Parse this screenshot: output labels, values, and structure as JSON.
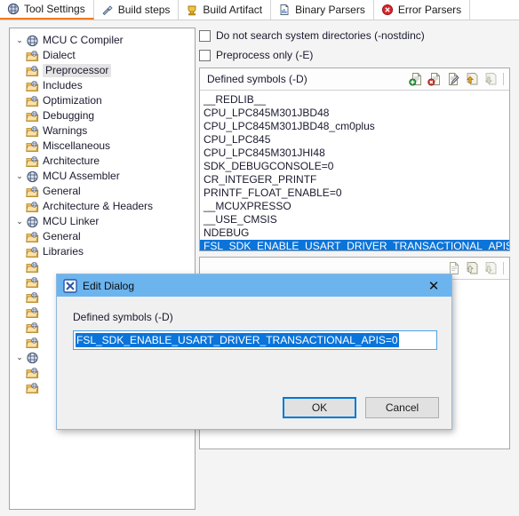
{
  "tabs": [
    {
      "label": "Tool Settings",
      "icon": "tool-settings-icon",
      "active": true
    },
    {
      "label": "Build steps",
      "icon": "build-steps-icon",
      "active": false
    },
    {
      "label": "Build Artifact",
      "icon": "build-artifact-icon",
      "active": false
    },
    {
      "label": "Binary Parsers",
      "icon": "binary-parsers-icon",
      "active": false
    },
    {
      "label": "Error Parsers",
      "icon": "error-parsers-icon",
      "active": false
    }
  ],
  "tree": [
    {
      "label": "MCU C Compiler",
      "level": 0,
      "expanded": true,
      "icon": "tool-icon",
      "selected": false
    },
    {
      "label": "Dialect",
      "level": 1,
      "icon": "folder-icon",
      "selected": false
    },
    {
      "label": "Preprocessor",
      "level": 1,
      "icon": "folder-icon",
      "selected": true
    },
    {
      "label": "Includes",
      "level": 1,
      "icon": "folder-icon",
      "selected": false
    },
    {
      "label": "Optimization",
      "level": 1,
      "icon": "folder-icon",
      "selected": false
    },
    {
      "label": "Debugging",
      "level": 1,
      "icon": "folder-icon",
      "selected": false
    },
    {
      "label": "Warnings",
      "level": 1,
      "icon": "folder-icon",
      "selected": false
    },
    {
      "label": "Miscellaneous",
      "level": 1,
      "icon": "folder-icon",
      "selected": false
    },
    {
      "label": "Architecture",
      "level": 1,
      "icon": "folder-icon",
      "selected": false
    },
    {
      "label": "MCU Assembler",
      "level": 0,
      "expanded": true,
      "icon": "tool-icon",
      "selected": false
    },
    {
      "label": "General",
      "level": 1,
      "icon": "folder-icon",
      "selected": false
    },
    {
      "label": "Architecture & Headers",
      "level": 1,
      "icon": "folder-icon",
      "selected": false
    },
    {
      "label": "MCU Linker",
      "level": 0,
      "expanded": true,
      "icon": "tool-icon",
      "selected": false
    },
    {
      "label": "General",
      "level": 1,
      "icon": "folder-icon",
      "selected": false
    },
    {
      "label": "Libraries",
      "level": 1,
      "icon": "folder-icon",
      "selected": false
    },
    {
      "label": "",
      "level": 1,
      "icon": "folder-icon",
      "selected": false
    },
    {
      "label": "",
      "level": 1,
      "icon": "folder-icon",
      "selected": false
    },
    {
      "label": "",
      "level": 1,
      "icon": "folder-icon",
      "selected": false
    },
    {
      "label": "",
      "level": 1,
      "icon": "folder-icon",
      "selected": false
    },
    {
      "label": "",
      "level": 1,
      "icon": "folder-icon",
      "selected": false
    },
    {
      "label": "",
      "level": 1,
      "icon": "folder-icon",
      "selected": false
    },
    {
      "label": "",
      "level": 0,
      "expanded": true,
      "icon": "tool-icon",
      "selected": false
    },
    {
      "label": "",
      "level": 1,
      "icon": "folder-icon",
      "selected": false
    },
    {
      "label": "",
      "level": 1,
      "icon": "folder-icon",
      "selected": false
    }
  ],
  "options": {
    "nostdinc": {
      "label": "Do not search system directories (-nostdinc)",
      "checked": false
    },
    "preprocess_only": {
      "label": "Preprocess only (-E)",
      "checked": false
    }
  },
  "defined_symbols": {
    "title": "Defined symbols (-D)",
    "toolbar": [
      {
        "name": "add-symbol-button",
        "title": "Add"
      },
      {
        "name": "delete-symbol-button",
        "title": "Delete"
      },
      {
        "name": "edit-symbol-button",
        "title": "Edit"
      },
      {
        "name": "move-up-button",
        "title": "Move Up"
      },
      {
        "name": "move-down-button",
        "title": "Move Down"
      }
    ],
    "items": [
      "__REDLIB__",
      "CPU_LPC845M301JBD48",
      "CPU_LPC845M301JBD48_cm0plus",
      "CPU_LPC845",
      "CPU_LPC845M301JHI48",
      "SDK_DEBUGCONSOLE=0",
      "CR_INTEGER_PRINTF",
      "PRINTF_FLOAT_ENABLE=0",
      "__MCUXPRESSO",
      "__USE_CMSIS",
      "NDEBUG",
      "FSL_SDK_ENABLE_USART_DRIVER_TRANSACTIONAL_APIS=0"
    ],
    "selected_index": 11
  },
  "undefined_symbols": {
    "title": "",
    "toolbar": [
      {
        "name": "edit-undef-button",
        "title": "Edit"
      },
      {
        "name": "move-up-undef-button",
        "title": "Move Up"
      },
      {
        "name": "move-down-undef-button",
        "title": "Move Down"
      }
    ],
    "items": []
  },
  "dialog": {
    "title": "Edit Dialog",
    "icon": "eclipse-x-icon",
    "close_label": "✕",
    "field_label": "Defined symbols (-D)",
    "input_value": "FSL_SDK_ENABLE_USART_DRIVER_TRANSACTIONAL_APIS=0",
    "ok_label": "OK",
    "cancel_label": "Cancel"
  },
  "colors": {
    "accent_tab": "#f07b1d",
    "selection_blue": "#0a74da",
    "title_blue": "#6cb4ee",
    "focus_blue": "#0078d7"
  }
}
